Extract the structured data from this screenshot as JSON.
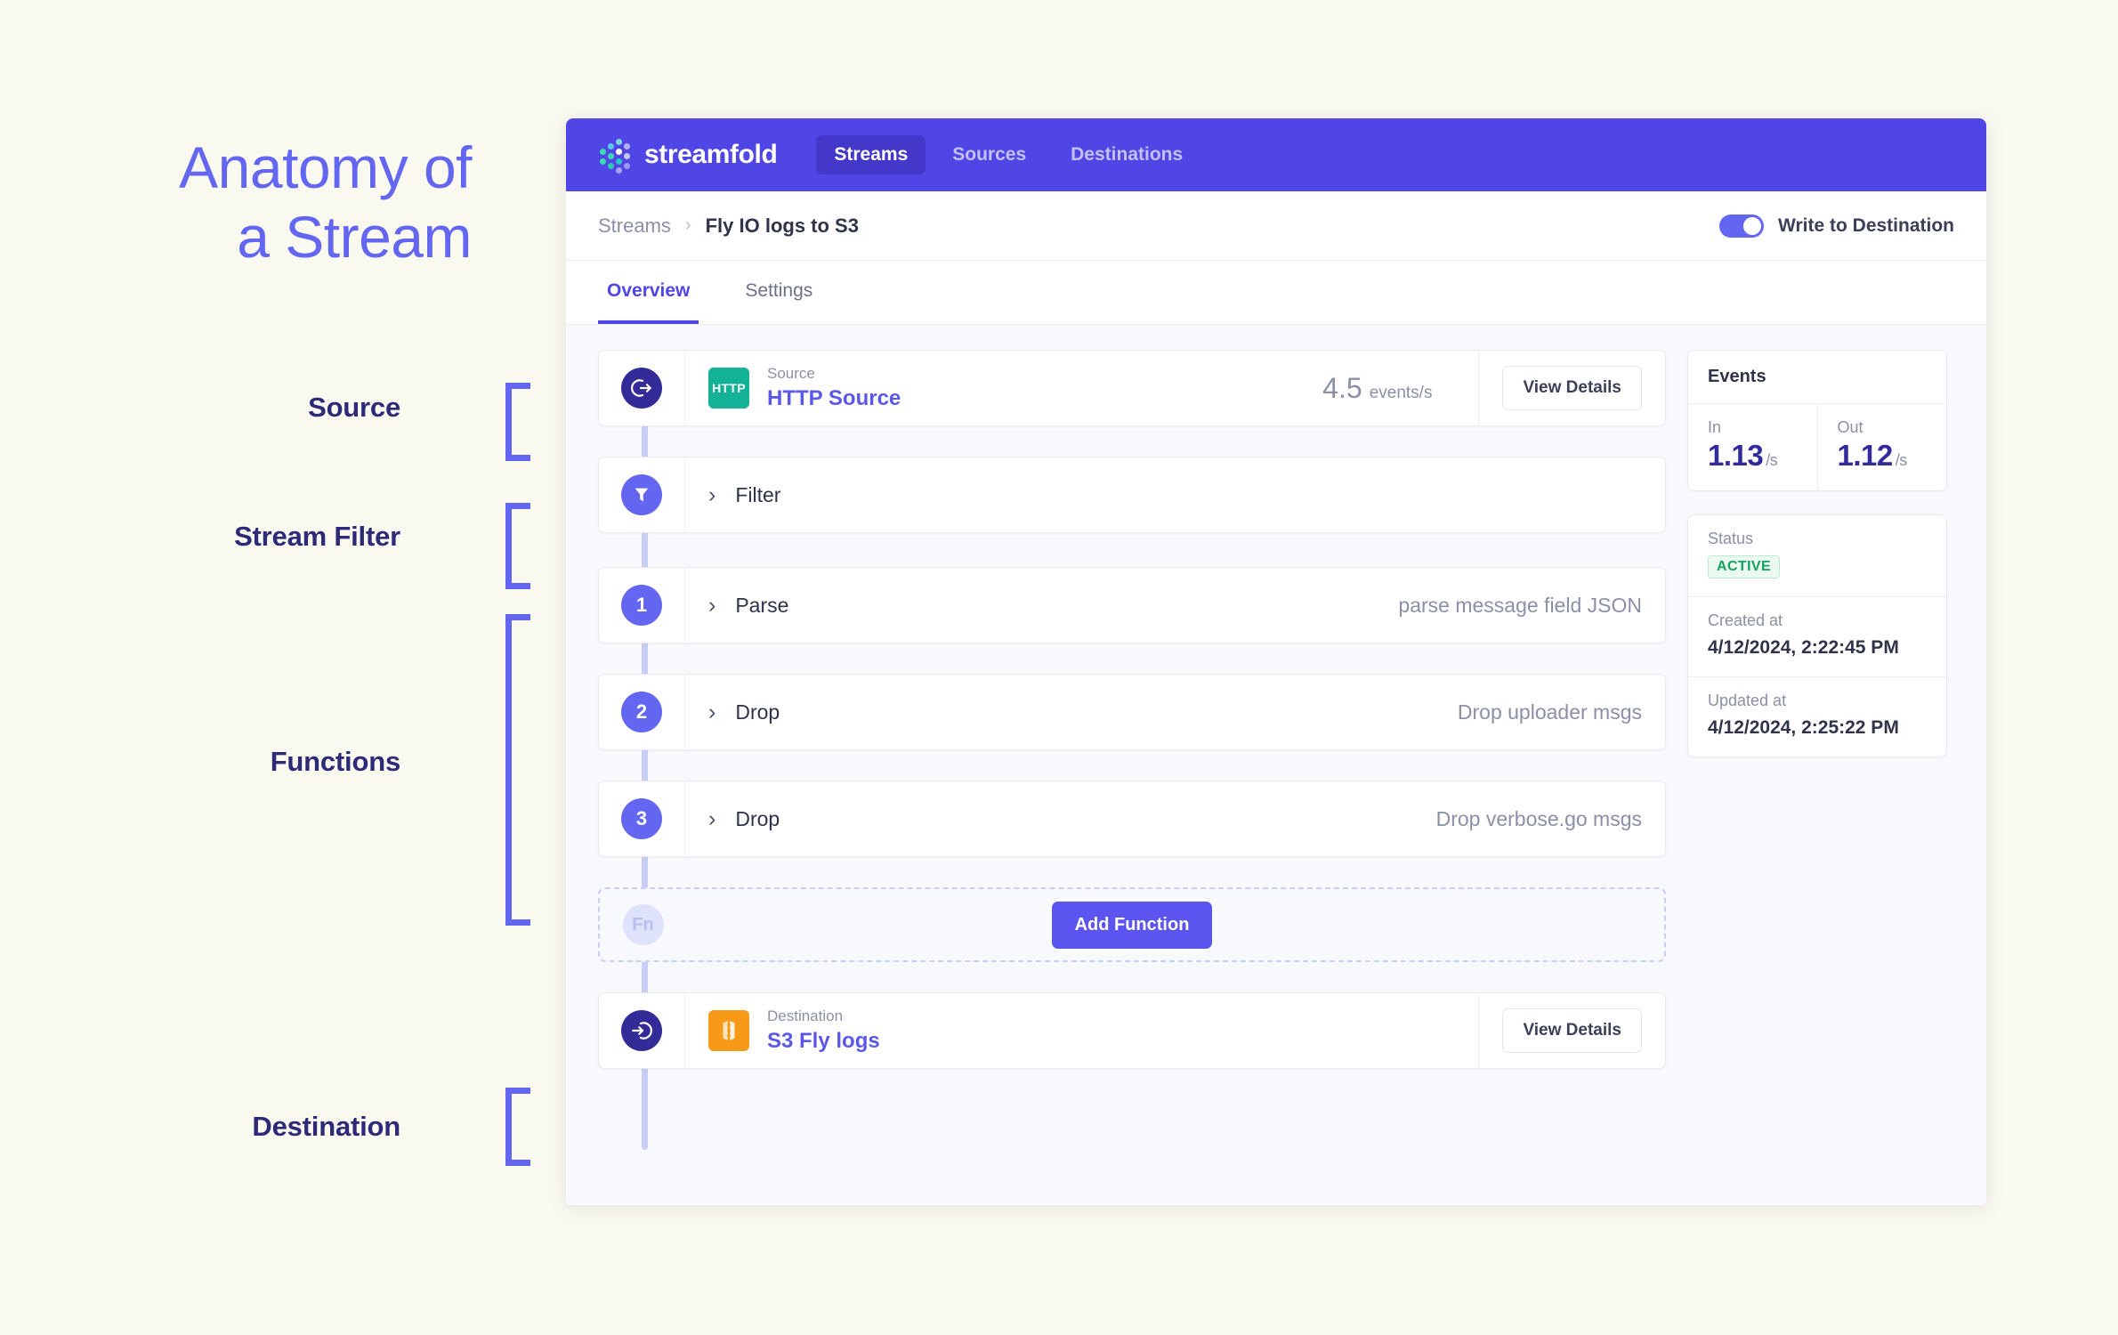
{
  "annotation": {
    "headline": "Anatomy of\na Stream",
    "labels": [
      {
        "text": "Source"
      },
      {
        "text": "Stream Filter"
      },
      {
        "text": "Functions"
      },
      {
        "text": "Destination"
      }
    ],
    "accent_color": "#6366f1",
    "label_color": "#2d2a78"
  },
  "app": {
    "brand": "streamfold",
    "nav": [
      {
        "label": "Streams",
        "active": true
      },
      {
        "label": "Sources",
        "active": false
      },
      {
        "label": "Destinations",
        "active": false
      }
    ],
    "breadcrumb": {
      "root": "Streams",
      "separator": "›",
      "current": "Fly IO logs to S3"
    },
    "write_to_destination": {
      "label": "Write to Destination",
      "on": true
    },
    "tabs": [
      {
        "label": "Overview",
        "active": true
      },
      {
        "label": "Settings",
        "active": false
      }
    ]
  },
  "pipeline": {
    "source": {
      "kicker": "Source",
      "name": "HTTP Source",
      "badge_text": "HTTP",
      "badge_color": "#13b196",
      "rate_value": "4.5",
      "rate_unit": "events/s",
      "action": "View Details"
    },
    "filter": {
      "name": "Filter",
      "chevron": "›"
    },
    "functions": [
      {
        "index": "1",
        "name": "Parse",
        "desc": "parse message field JSON",
        "chevron": "›"
      },
      {
        "index": "2",
        "name": "Drop",
        "desc": "Drop uploader msgs",
        "chevron": "›"
      },
      {
        "index": "3",
        "name": "Drop",
        "desc": "Drop verbose.go msgs",
        "chevron": "›"
      }
    ],
    "add_function": {
      "icon_text": "Fn",
      "button_label": "Add Function"
    },
    "destination": {
      "kicker": "Destination",
      "name": "S3 Fly logs",
      "badge_color": "#f79a17",
      "action": "View Details"
    }
  },
  "side": {
    "events": {
      "title": "Events",
      "in": {
        "label": "In",
        "value": "1.13",
        "unit": "/s"
      },
      "out": {
        "label": "Out",
        "value": "1.12",
        "unit": "/s"
      }
    },
    "details": {
      "status": {
        "label": "Status",
        "value": "ACTIVE",
        "color": "#13a35c"
      },
      "created": {
        "label": "Created at",
        "value": "4/12/2024, 2:22:45 PM"
      },
      "updated": {
        "label": "Updated at",
        "value": "4/12/2024, 2:25:22 PM"
      }
    }
  }
}
